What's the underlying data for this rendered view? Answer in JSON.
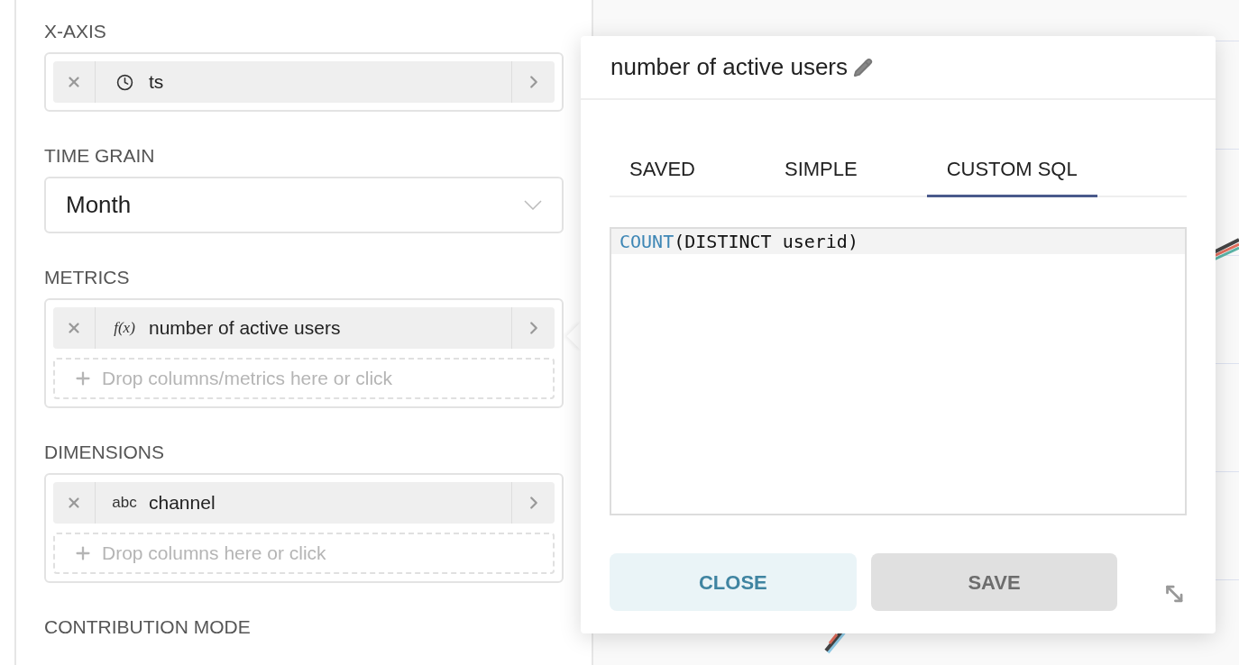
{
  "sections": [
    {
      "label": "X-AXIS",
      "kind": "chips",
      "chips": [
        {
          "kind": "temporal",
          "text": "ts"
        }
      ]
    },
    {
      "label": "TIME GRAIN",
      "kind": "select",
      "value": "Month"
    },
    {
      "label": "METRICS",
      "kind": "chips",
      "chips": [
        {
          "kind": "metric",
          "type_label": "f(x)",
          "text": "number of active users"
        }
      ],
      "drop_placeholder": "Drop columns/metrics here or click"
    },
    {
      "label": "DIMENSIONS",
      "kind": "chips",
      "chips": [
        {
          "kind": "string",
          "type_label": "abc",
          "text": "channel"
        }
      ],
      "drop_placeholder": "Drop columns here or click"
    },
    {
      "label": "CONTRIBUTION MODE",
      "kind": "label_only"
    }
  ],
  "popover": {
    "title": "number of active users",
    "tabs": [
      {
        "label": "SAVED",
        "selected": false
      },
      {
        "label": "SIMPLE",
        "selected": false
      },
      {
        "label": "CUSTOM SQL",
        "selected": true
      }
    ],
    "editor": {
      "lines": [
        [
          {
            "kind": "function",
            "text": "COUNT"
          },
          {
            "kind": "plain",
            "text": "(DISTINCT userid)"
          }
        ]
      ]
    },
    "buttons": [
      {
        "label": "CLOSE",
        "kind": "secondary"
      },
      {
        "label": "SAVE",
        "kind": "disabled"
      }
    ]
  }
}
